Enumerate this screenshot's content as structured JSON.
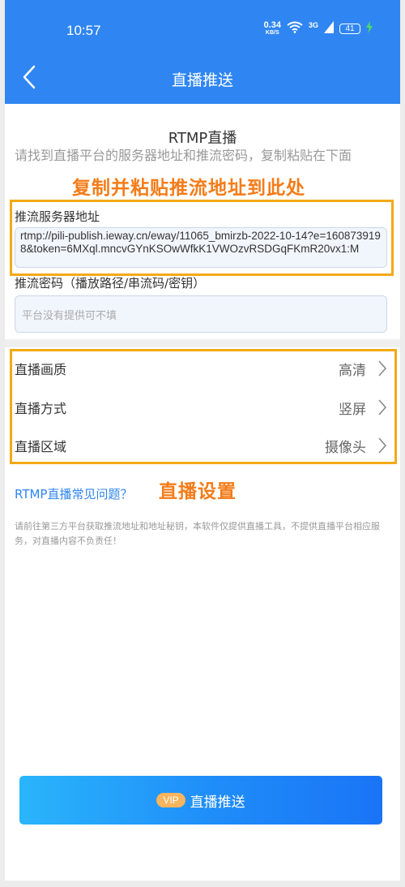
{
  "status_bar": {
    "time": "10:57",
    "speed_value": "0.34",
    "speed_unit": "KB/S",
    "network": "3G",
    "battery": "41"
  },
  "header": {
    "title": "直播推送"
  },
  "section": {
    "title": "RTMP直播",
    "hint": "请找到直播平台的服务器地址和推流密码，复制粘贴在下面"
  },
  "annotations": {
    "paste_hint": "复制并粘贴推流地址到此处",
    "settings_hint": "直播设置"
  },
  "server": {
    "label": "推流服务器地址",
    "value": "rtmp://pili-publish.ieway.cn/eway/11065_bmirzb-2022-10-14?e=1608739198&token=6MXql.mncvGYnKSOwWfkK1VWOzvRSDGqFKmR20vx1:M"
  },
  "stream_key": {
    "label": "推流密码（播放路径/串流码/密钥）",
    "placeholder": "平台没有提供可不填"
  },
  "settings": [
    {
      "label": "直播画质",
      "value": "高清"
    },
    {
      "label": "直播方式",
      "value": "竖屏"
    },
    {
      "label": "直播区域",
      "value": "摄像头"
    }
  ],
  "faq_link": "RTMP直播常见问题？",
  "disclaimer": "请前往第三方平台获取推流地址和地址秘钥，本软件仅提供直播工具，不提供直播平台相应服务，对直播内容不负责任！",
  "push_button": {
    "badge": "VIP",
    "label": "直播推送"
  },
  "colors": {
    "primary": "#2f86f2",
    "annotation_text": "#f47c19",
    "annotation_border": "#f4a915",
    "vip_badge": "#f9b45e"
  }
}
